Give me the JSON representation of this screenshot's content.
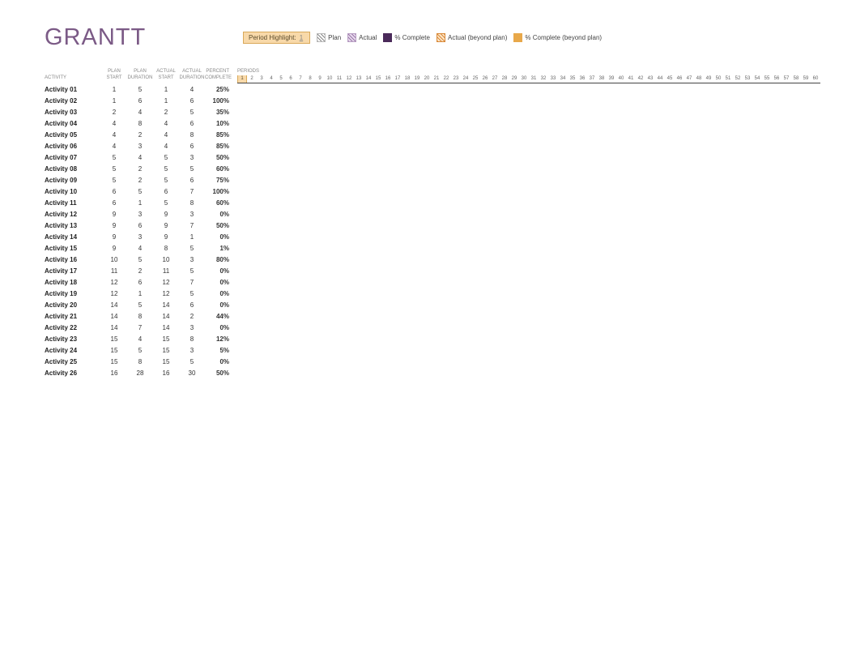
{
  "title": "GRANTT",
  "legend": {
    "highlight_label": "Period Highlight:",
    "highlight_value": "1",
    "plan": "Plan",
    "actual": "Actual",
    "pct_complete": "% Complete",
    "actual_beyond": "Actual (beyond plan)",
    "pct_beyond": "% Complete (beyond plan)"
  },
  "headers": {
    "activity": "ACTIVITY",
    "plan_start": "PLAN START",
    "plan_duration": "PLAN DURATION",
    "actual_start": "ACTUAL START",
    "actual_duration": "ACTUAL DURATION",
    "percent_complete": "PERCENT COMPLETE",
    "periods": "PERIODS"
  },
  "periods_count": 60,
  "highlight_period": 1,
  "rows": [
    {
      "activity": "Activity 01",
      "plan_start": 1,
      "plan_duration": 5,
      "actual_start": 1,
      "actual_duration": 4,
      "pct": "25%"
    },
    {
      "activity": "Activity 02",
      "plan_start": 1,
      "plan_duration": 6,
      "actual_start": 1,
      "actual_duration": 6,
      "pct": "100%"
    },
    {
      "activity": "Activity 03",
      "plan_start": 2,
      "plan_duration": 4,
      "actual_start": 2,
      "actual_duration": 5,
      "pct": "35%"
    },
    {
      "activity": "Activity 04",
      "plan_start": 4,
      "plan_duration": 8,
      "actual_start": 4,
      "actual_duration": 6,
      "pct": "10%"
    },
    {
      "activity": "Activity 05",
      "plan_start": 4,
      "plan_duration": 2,
      "actual_start": 4,
      "actual_duration": 8,
      "pct": "85%"
    },
    {
      "activity": "Activity 06",
      "plan_start": 4,
      "plan_duration": 3,
      "actual_start": 4,
      "actual_duration": 6,
      "pct": "85%"
    },
    {
      "activity": "Activity 07",
      "plan_start": 5,
      "plan_duration": 4,
      "actual_start": 5,
      "actual_duration": 3,
      "pct": "50%"
    },
    {
      "activity": "Activity 08",
      "plan_start": 5,
      "plan_duration": 2,
      "actual_start": 5,
      "actual_duration": 5,
      "pct": "60%"
    },
    {
      "activity": "Activity 09",
      "plan_start": 5,
      "plan_duration": 2,
      "actual_start": 5,
      "actual_duration": 6,
      "pct": "75%"
    },
    {
      "activity": "Activity 10",
      "plan_start": 6,
      "plan_duration": 5,
      "actual_start": 6,
      "actual_duration": 7,
      "pct": "100%"
    },
    {
      "activity": "Activity 11",
      "plan_start": 6,
      "plan_duration": 1,
      "actual_start": 5,
      "actual_duration": 8,
      "pct": "60%"
    },
    {
      "activity": "Activity 12",
      "plan_start": 9,
      "plan_duration": 3,
      "actual_start": 9,
      "actual_duration": 3,
      "pct": "0%"
    },
    {
      "activity": "Activity 13",
      "plan_start": 9,
      "plan_duration": 6,
      "actual_start": 9,
      "actual_duration": 7,
      "pct": "50%"
    },
    {
      "activity": "Activity 14",
      "plan_start": 9,
      "plan_duration": 3,
      "actual_start": 9,
      "actual_duration": 1,
      "pct": "0%"
    },
    {
      "activity": "Activity 15",
      "plan_start": 9,
      "plan_duration": 4,
      "actual_start": 8,
      "actual_duration": 5,
      "pct": "1%"
    },
    {
      "activity": "Activity 16",
      "plan_start": 10,
      "plan_duration": 5,
      "actual_start": 10,
      "actual_duration": 3,
      "pct": "80%"
    },
    {
      "activity": "Activity 17",
      "plan_start": 11,
      "plan_duration": 2,
      "actual_start": 11,
      "actual_duration": 5,
      "pct": "0%"
    },
    {
      "activity": "Activity 18",
      "plan_start": 12,
      "plan_duration": 6,
      "actual_start": 12,
      "actual_duration": 7,
      "pct": "0%"
    },
    {
      "activity": "Activity 19",
      "plan_start": 12,
      "plan_duration": 1,
      "actual_start": 12,
      "actual_duration": 5,
      "pct": "0%"
    },
    {
      "activity": "Activity 20",
      "plan_start": 14,
      "plan_duration": 5,
      "actual_start": 14,
      "actual_duration": 6,
      "pct": "0%"
    },
    {
      "activity": "Activity 21",
      "plan_start": 14,
      "plan_duration": 8,
      "actual_start": 14,
      "actual_duration": 2,
      "pct": "44%"
    },
    {
      "activity": "Activity 22",
      "plan_start": 14,
      "plan_duration": 7,
      "actual_start": 14,
      "actual_duration": 3,
      "pct": "0%"
    },
    {
      "activity": "Activity 23",
      "plan_start": 15,
      "plan_duration": 4,
      "actual_start": 15,
      "actual_duration": 8,
      "pct": "12%"
    },
    {
      "activity": "Activity 24",
      "plan_start": 15,
      "plan_duration": 5,
      "actual_start": 15,
      "actual_duration": 3,
      "pct": "5%"
    },
    {
      "activity": "Activity 25",
      "plan_start": 15,
      "plan_duration": 8,
      "actual_start": 15,
      "actual_duration": 5,
      "pct": "0%"
    },
    {
      "activity": "Activity 26",
      "plan_start": 16,
      "plan_duration": 28,
      "actual_start": 16,
      "actual_duration": 30,
      "pct": "50%"
    }
  ]
}
